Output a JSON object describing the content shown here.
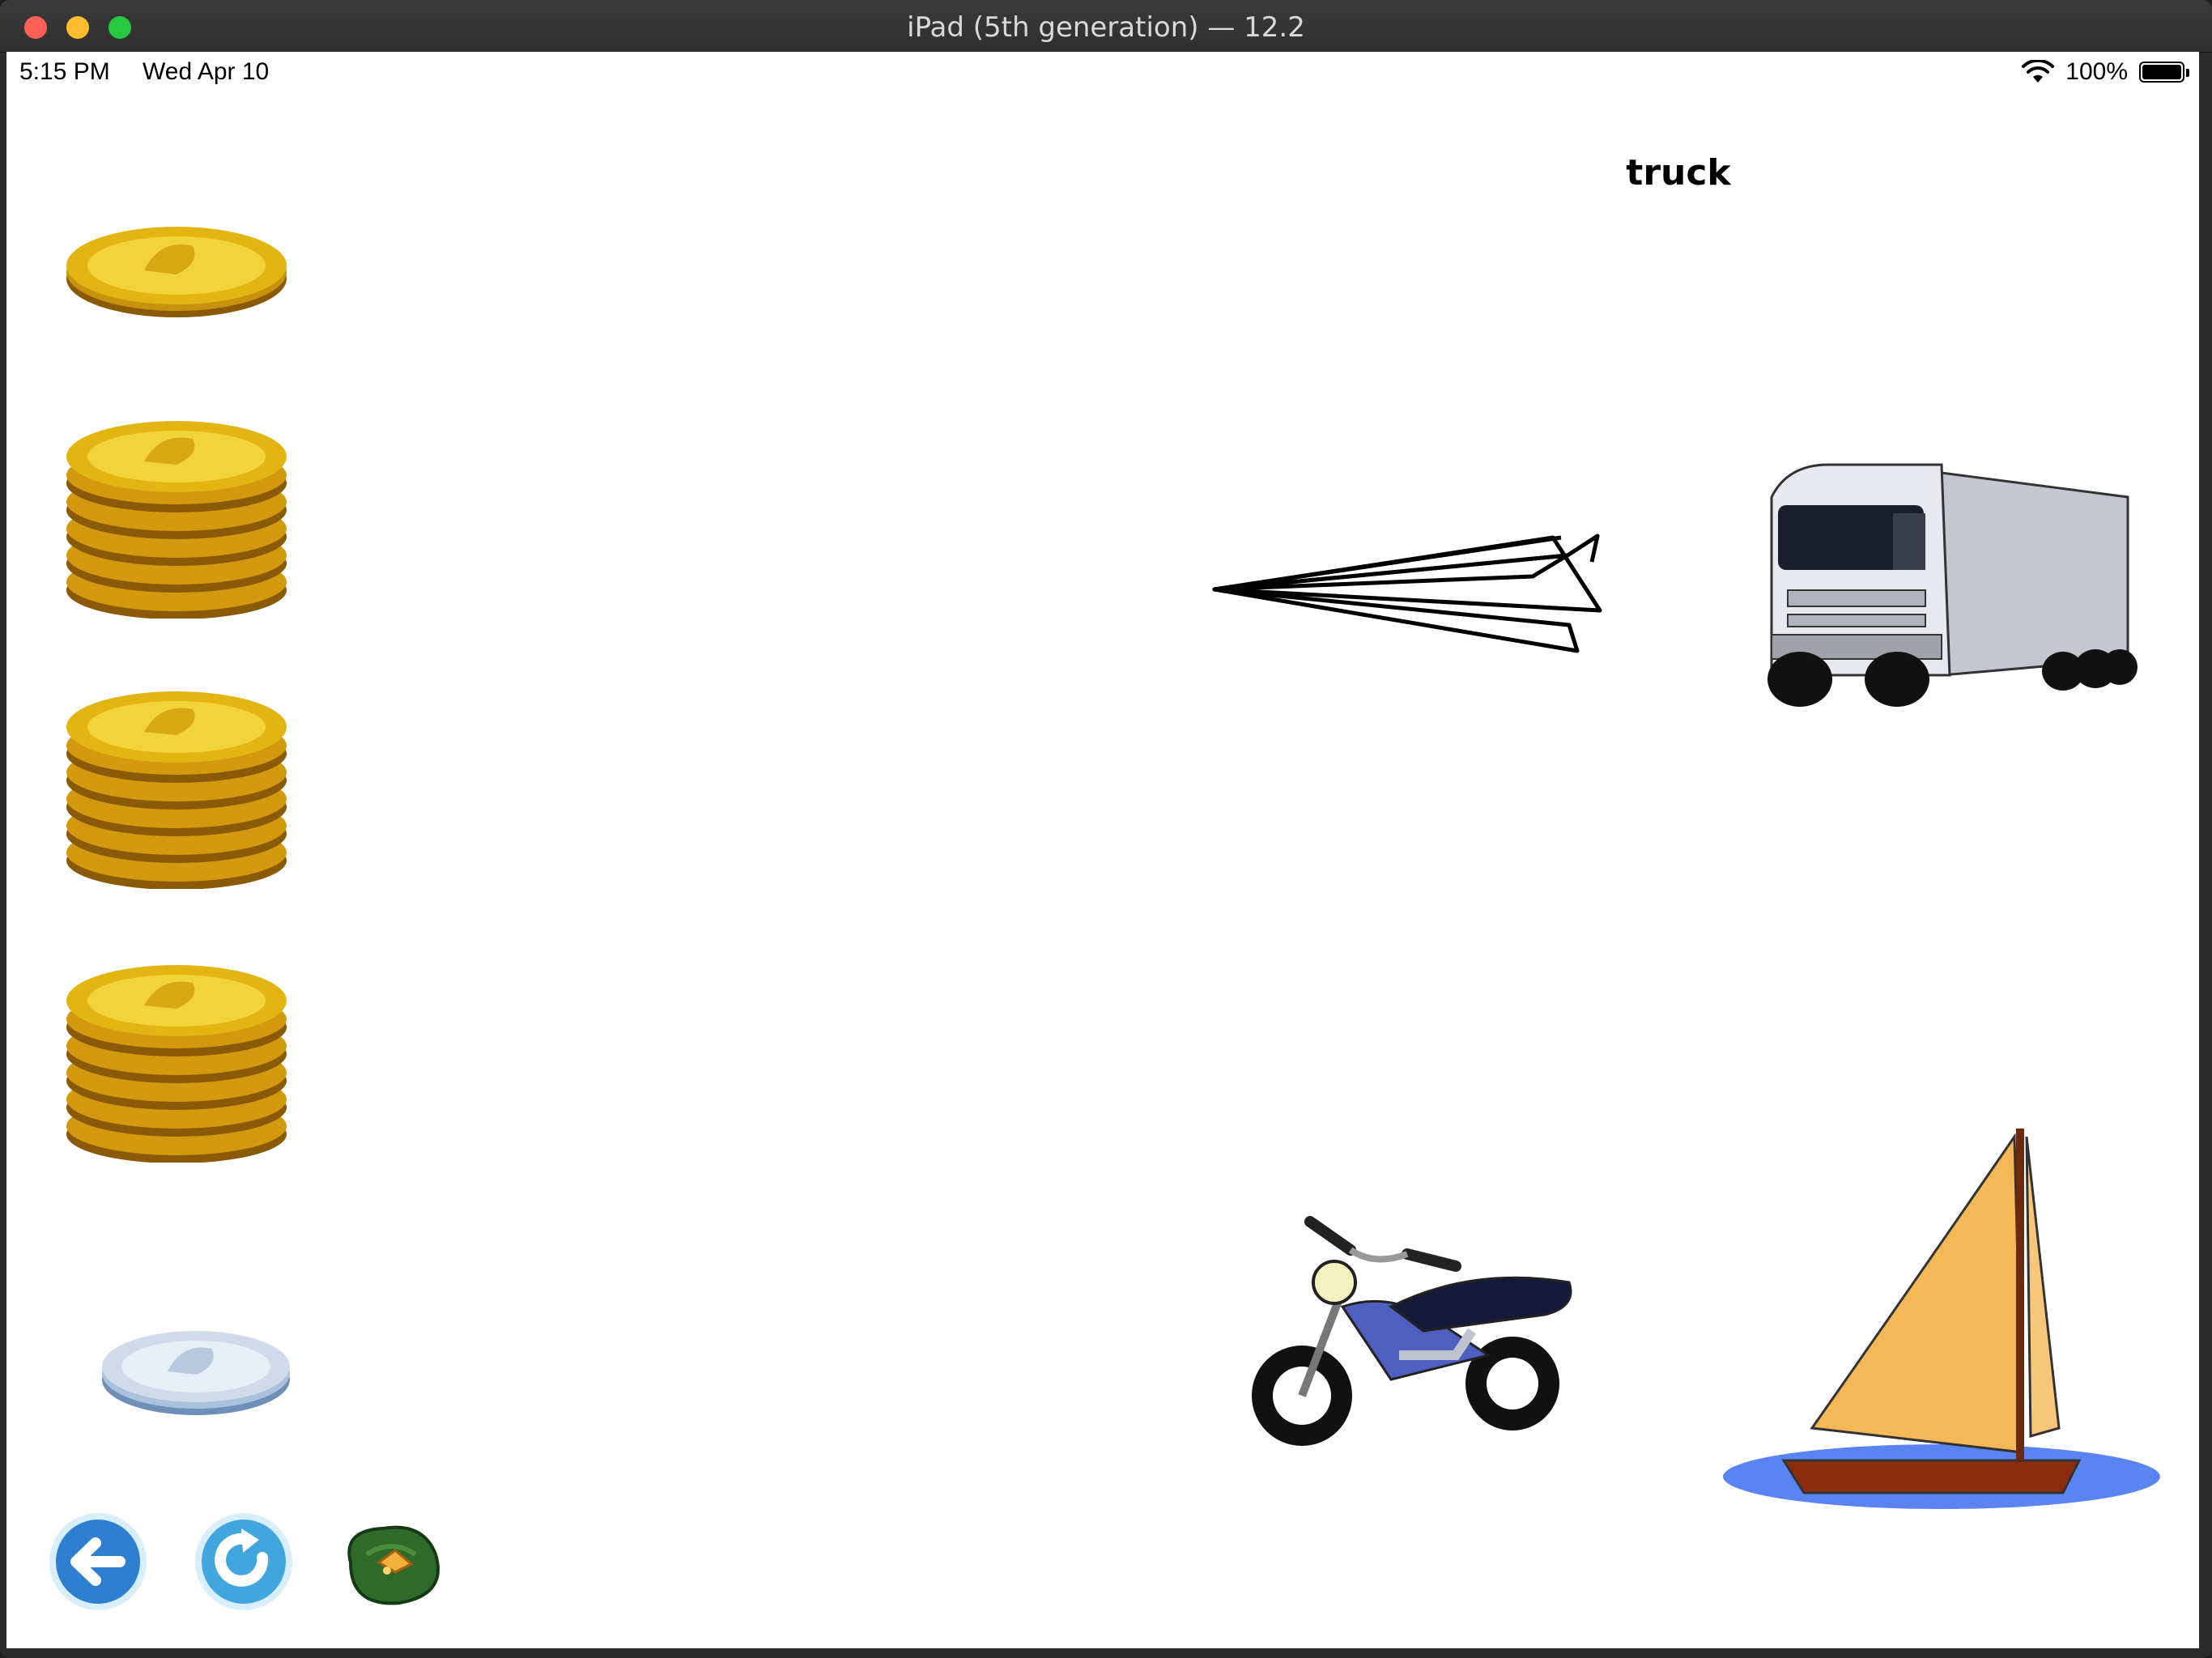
{
  "window": {
    "title": "iPad (5th generation) — 12.2"
  },
  "status_bar": {
    "time": "5:15 PM",
    "date": "Wed Apr 10",
    "battery": "100%"
  },
  "game": {
    "target_word": "truck",
    "coin_stacks": [
      {
        "type": "gold",
        "coins": 1
      },
      {
        "type": "gold",
        "coins": 6
      },
      {
        "type": "gold",
        "coins": 6
      },
      {
        "type": "gold",
        "coins": 6
      },
      {
        "type": "silver",
        "coins": 1
      }
    ],
    "vehicles": [
      "paper-airplane",
      "truck",
      "motorcycle",
      "sailboat"
    ]
  },
  "toolbar": {
    "buttons": [
      "back-button",
      "reload-button",
      "treasure-bag-button"
    ]
  },
  "colors": {
    "gold": "#e3b513",
    "silver": "#bcd0e6",
    "blue_button": "#2f7fd0",
    "light_blue_button": "#41a6dd"
  }
}
